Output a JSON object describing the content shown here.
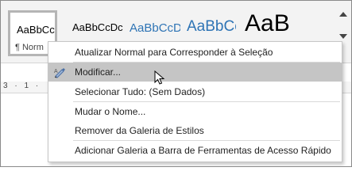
{
  "styles_gallery": {
    "items": [
      {
        "preview": "AaBbCcDc",
        "label": "¶ Norm"
      },
      {
        "preview": "AaBbCcDc"
      },
      {
        "preview": "AaBbCcD"
      },
      {
        "preview": "AaBbCc"
      },
      {
        "preview": "AaB"
      }
    ]
  },
  "ruler": {
    "text": "3 · 1 ·"
  },
  "context_menu": {
    "items": [
      {
        "label": "Atualizar Normal para Corresponder à Seleção"
      },
      {
        "label": "Modificar..."
      },
      {
        "label": "Selecionar Tudo: (Sem Dados)"
      },
      {
        "label": "Mudar o Nome..."
      },
      {
        "label": "Remover da Galeria de Estilos"
      },
      {
        "label": "Adicionar Galeria a Barra de Ferramentas de Acesso Rápido"
      }
    ],
    "highlighted_index": 1,
    "icons": {
      "modify": "pen-style-icon"
    }
  },
  "colors": {
    "heading_blue": "#2e74b5",
    "highlight": "#c5c5c5"
  }
}
